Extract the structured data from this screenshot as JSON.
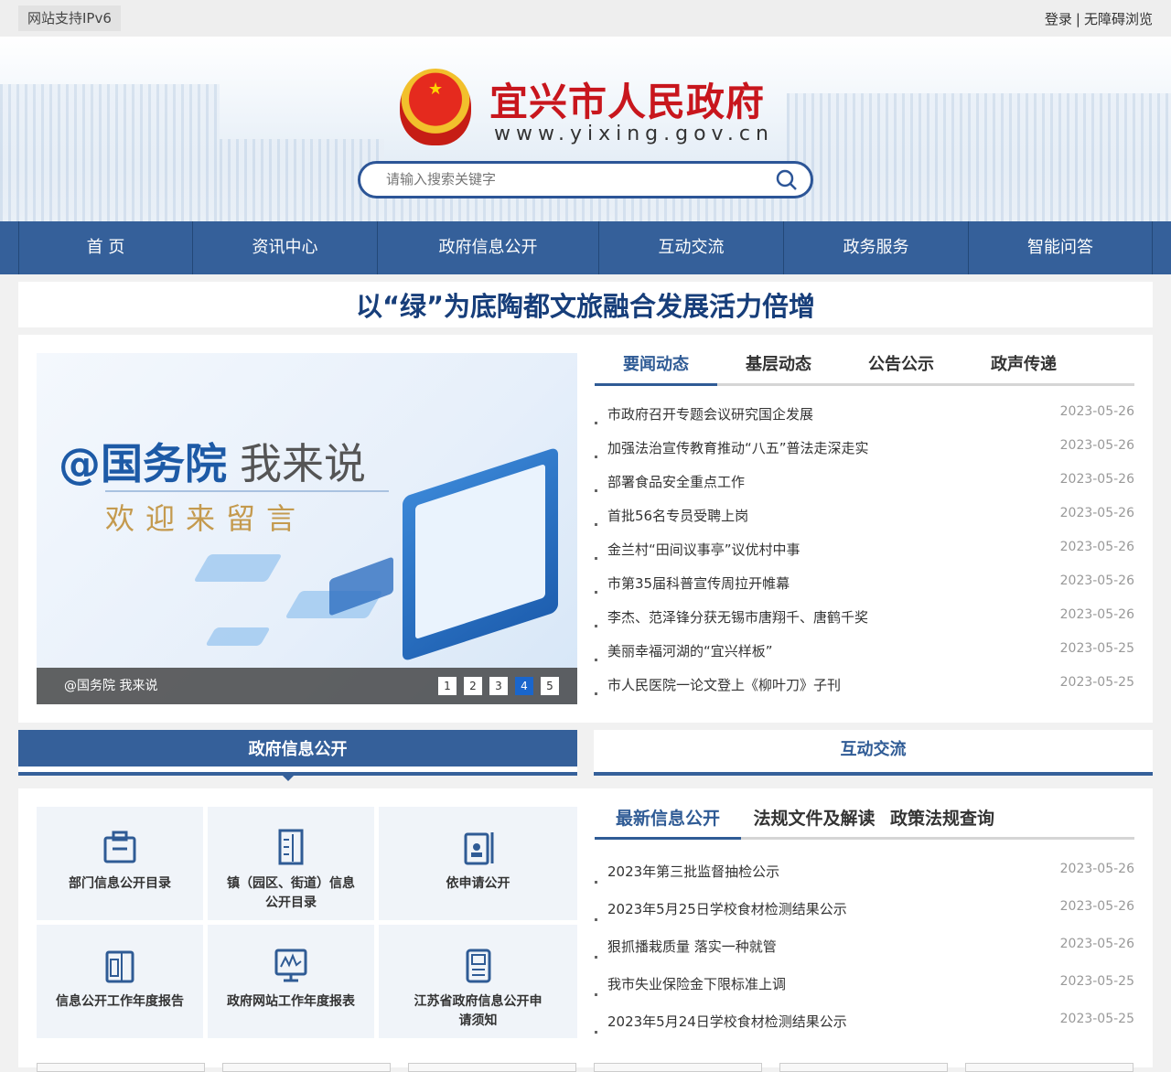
{
  "topbar": {
    "ipv6": "网站支持IPv6",
    "login": "登录",
    "sep": "|",
    "accessible": "无障碍浏览"
  },
  "header": {
    "title": "宜兴市人民政府",
    "url": "www.yixing.gov.cn",
    "search_placeholder": "请输入搜索关键字"
  },
  "nav": [
    {
      "label": "首 页"
    },
    {
      "label": "资讯中心"
    },
    {
      "label": "政府信息公开"
    },
    {
      "label": "互动交流"
    },
    {
      "label": "政务服务"
    },
    {
      "label": "智能问答"
    }
  ],
  "headline": "以“绿”为底陶都文旅融合发展活力倍增",
  "carousel": {
    "title": "@国务院",
    "title2": "我来说",
    "subtitle": "欢迎来留言",
    "caption": "@国务院 我来说",
    "pages": [
      "1",
      "2",
      "3",
      "4",
      "5"
    ],
    "active": 4
  },
  "news": {
    "tabs": [
      "要闻动态",
      "基层动态",
      "公告公示",
      "政声传递"
    ],
    "active": 0,
    "items": [
      {
        "title": "市政府召开专题会议研究国企发展",
        "date": "2023-05-26"
      },
      {
        "title": "加强法治宣传教育推动“八五”普法走深走实",
        "date": "2023-05-26"
      },
      {
        "title": "部署食品安全重点工作",
        "date": "2023-05-26"
      },
      {
        "title": "首批56名专员受聘上岗",
        "date": "2023-05-26"
      },
      {
        "title": "金兰村“田间议事亭”议优村中事",
        "date": "2023-05-26"
      },
      {
        "title": "市第35届科普宣传周拉开帷幕",
        "date": "2023-05-26"
      },
      {
        "title": "李杰、范泽锋分获无锡市唐翔千、唐鹤千奖",
        "date": "2023-05-26"
      },
      {
        "title": "美丽幸福河湖的“宜兴样板”",
        "date": "2023-05-25"
      },
      {
        "title": "市人民医院一论文登上《柳叶刀》子刊",
        "date": "2023-05-25"
      }
    ]
  },
  "sections": {
    "left": "政府信息公开",
    "right": "互动交流"
  },
  "tiles": [
    {
      "label": "部门信息公开目录",
      "icon": "briefcase-icon"
    },
    {
      "label": "镇（园区、街道）信息公开目录",
      "icon": "building-icon"
    },
    {
      "label": "依申请公开",
      "icon": "id-card-icon"
    },
    {
      "label": "信息公开工作年度报告",
      "icon": "report-icon"
    },
    {
      "label": "政府网站工作年度报表",
      "icon": "monitor-chart-icon"
    },
    {
      "label": "江苏省政府信息公开申请须知",
      "icon": "document-icon"
    }
  ],
  "info": {
    "tabs": [
      "最新信息公开",
      "法规文件及解读",
      "政策法规查询"
    ],
    "active": 0,
    "items": [
      {
        "title": "2023年第三批监督抽检公示",
        "date": "2023-05-26"
      },
      {
        "title": "2023年5月25日学校食材检测结果公示",
        "date": "2023-05-26"
      },
      {
        "title": "狠抓播栽质量 落实一种就管",
        "date": "2023-05-26"
      },
      {
        "title": "我市失业保险金下限标准上调",
        "date": "2023-05-25"
      },
      {
        "title": "2023年5月24日学校食材检测结果公示",
        "date": "2023-05-25"
      }
    ]
  },
  "colors": {
    "primary": "#35609a",
    "title_red": "#c8161d",
    "headline": "#173e7a"
  }
}
